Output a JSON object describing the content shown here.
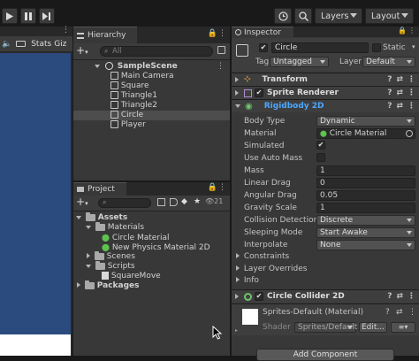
{
  "toolbar": {
    "layers_label": "Layers",
    "layout_label": "Layout"
  },
  "scene": {
    "stats_label": "Stats",
    "gizmos_label": "Giz"
  },
  "hierarchy": {
    "tab_label": "Hierarchy",
    "search_placeholder": "All",
    "scene_name": "SampleScene",
    "items": [
      "Main Camera",
      "Square",
      "Triangle1",
      "Triangle2",
      "Circle",
      "Player"
    ],
    "selected": "Circle"
  },
  "project": {
    "tab_label": "Project",
    "count": "21",
    "tree": {
      "assets": "Assets",
      "materials": "Materials",
      "circle_material": "Circle Material",
      "new_physics_material": "New Physics Material 2D",
      "scenes": "Scenes",
      "scripts": "Scripts",
      "square_move": "SquareMove",
      "packages": "Packages"
    }
  },
  "inspector": {
    "tab_label": "Inspector",
    "object_name": "Circle",
    "static_label": "Static",
    "tag_label": "Tag",
    "tag_value": "Untagged",
    "layer_label": "Layer",
    "layer_value": "Default",
    "components": {
      "transform": "Transform",
      "sprite_renderer": "Sprite Renderer",
      "rigidbody": "Rigidbody 2D",
      "circle_collider": "Circle Collider 2D"
    },
    "rigidbody": {
      "body_type_label": "Body Type",
      "body_type_value": "Dynamic",
      "material_label": "Material",
      "material_value": "Circle Material",
      "simulated_label": "Simulated",
      "use_auto_mass_label": "Use Auto Mass",
      "mass_label": "Mass",
      "mass_value": "1",
      "linear_drag_label": "Linear Drag",
      "linear_drag_value": "0",
      "angular_drag_label": "Angular Drag",
      "angular_drag_value": "0.05",
      "gravity_scale_label": "Gravity Scale",
      "gravity_scale_value": "1",
      "collision_detection_label": "Collision Detection",
      "collision_detection_value": "Discrete",
      "sleeping_mode_label": "Sleeping Mode",
      "sleeping_mode_value": "Start Awake",
      "interpolate_label": "Interpolate",
      "interpolate_value": "None",
      "constraints_label": "Constraints",
      "layer_overrides_label": "Layer Overrides",
      "info_label": "Info"
    },
    "material_preview": {
      "title": "Sprites-Default (Material)",
      "shader_label": "Shader",
      "shader_value": "Sprites/Default",
      "edit_label": "Edit...",
      "list_icon": "list-icon"
    },
    "add_component_label": "Add Component"
  },
  "colors": {
    "scene_blue": "#2b4a7e",
    "selection_blue": "#2c5d87",
    "link_blue": "#4aa8ff"
  }
}
